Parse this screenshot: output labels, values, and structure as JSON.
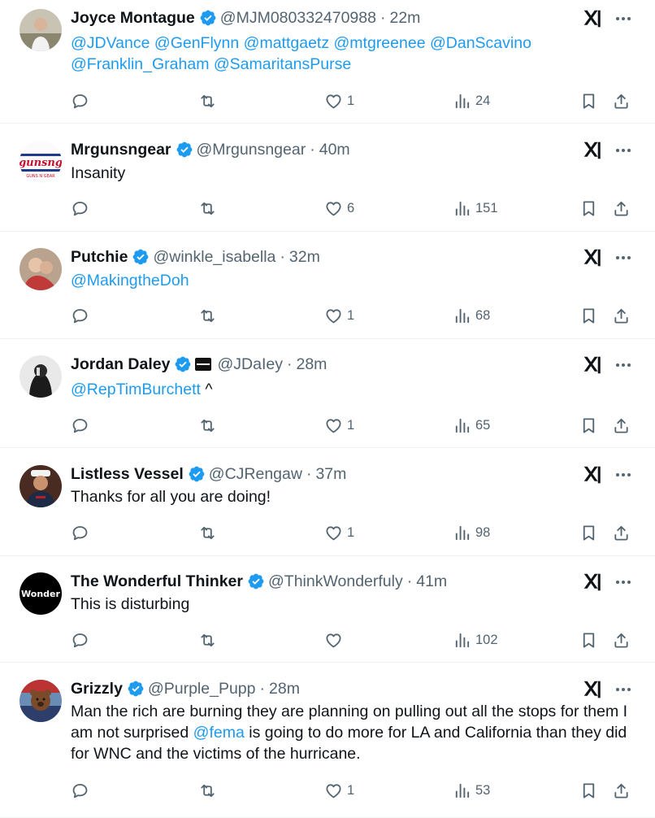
{
  "tweets": [
    {
      "name": "Joyce Montague",
      "handle": "@MJM080332470988",
      "time": "22m",
      "body": [
        {
          "t": "@JDVance",
          "m": true
        },
        {
          "t": " ",
          "m": false
        },
        {
          "t": "@GenFlynn",
          "m": true
        },
        {
          "t": " ",
          "m": false
        },
        {
          "t": "@mattgaetz",
          "m": true
        },
        {
          "t": " ",
          "m": false
        },
        {
          "t": "@mtgreenee",
          "m": true
        },
        {
          "t": " ",
          "m": false
        },
        {
          "t": "@DanScavino",
          "m": true
        },
        {
          "t": " ",
          "m": false
        },
        {
          "t": "@Franklin_Graham",
          "m": true
        },
        {
          "t": " ",
          "m": false
        },
        {
          "t": "@SamaritansPurse",
          "m": true
        }
      ],
      "likes": "1",
      "views": "24",
      "avatar": "photo-woman",
      "flag": false
    },
    {
      "name": "Mrgunsngear",
      "handle": "@Mrgunsngear",
      "time": "40m",
      "body": [
        {
          "t": "Insanity",
          "m": false
        }
      ],
      "likes": "6",
      "views": "151",
      "avatar": "logo-gunsngear",
      "flag": false
    },
    {
      "name": "Putchie",
      "handle": "@winkle_isabella",
      "time": "32m",
      "body": [
        {
          "t": "@MakingtheDoh",
          "m": true
        }
      ],
      "likes": "1",
      "views": "68",
      "avatar": "photo-couple",
      "flag": false
    },
    {
      "name": "Jordan Daley",
      "handle": "@JDaIey",
      "time": "28m",
      "body": [
        {
          "t": "@RepTimBurchett",
          "m": true
        },
        {
          "t": " ^",
          "m": false
        }
      ],
      "likes": "1",
      "views": "65",
      "avatar": "photo-man-hood",
      "flag": true
    },
    {
      "name": "Listless Vessel",
      "handle": "@CJRengaw",
      "time": "37m",
      "body": [
        {
          "t": "Thanks for all you are doing!",
          "m": false
        }
      ],
      "likes": "1",
      "views": "98",
      "avatar": "photo-marine",
      "flag": false
    },
    {
      "name": "The Wonderful Thinker",
      "handle": "@ThinkWonderfuly",
      "time": "41m",
      "body": [
        {
          "t": "This is disturbing",
          "m": false
        }
      ],
      "likes": "",
      "views": "102",
      "avatar": "logo-wonder",
      "avatar_text": "Wonder",
      "flag": false
    },
    {
      "name": "Grizzly",
      "handle": "@Purple_Pupp",
      "time": "28m",
      "body": [
        {
          "t": "Man the rich are burning they are planning on pulling out all the stops for them I am not surprised ",
          "m": false
        },
        {
          "t": "@fema",
          "m": true
        },
        {
          "t": " is going to do more for LA and California than they did for WNC and the victims of the hurricane.",
          "m": false
        }
      ],
      "likes": "1",
      "views": "53",
      "avatar": "photo-bear",
      "flag": false
    }
  ],
  "icons": {
    "verified": "verified-badge-icon",
    "grok": "grok-icon",
    "more": "more-icon",
    "reply": "reply-icon",
    "retweet": "retweet-icon",
    "like": "like-icon",
    "views": "views-icon",
    "bookmark": "bookmark-icon",
    "share": "share-icon"
  },
  "colors": {
    "text": "#0f1419",
    "secondary": "#536471",
    "accent": "#1d9bf0",
    "divider": "#eff3f4"
  }
}
